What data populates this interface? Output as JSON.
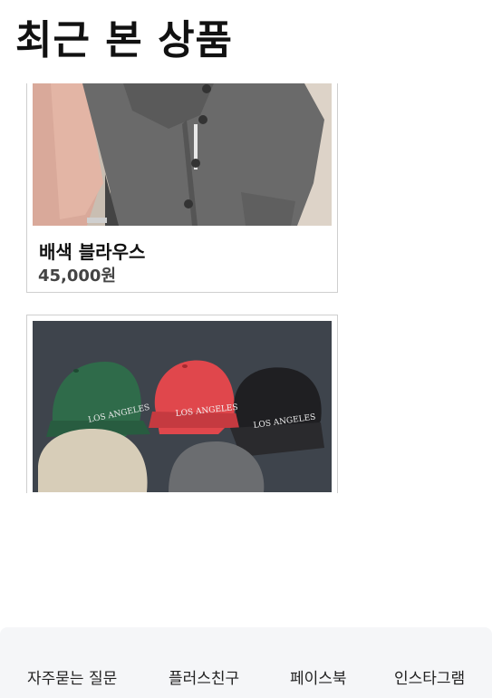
{
  "page": {
    "title": "최근 본 상품"
  },
  "products": [
    {
      "name": "배색 블라우스",
      "price": "45,000원",
      "image": "gray-blouse-photo"
    },
    {
      "name": "",
      "price": "",
      "image": "caps-photo",
      "image_text": "LOS ANGELES"
    }
  ],
  "footer": {
    "links": [
      "자주묻는 질문",
      "플러스친구",
      "페이스북",
      "인스타그램"
    ]
  }
}
